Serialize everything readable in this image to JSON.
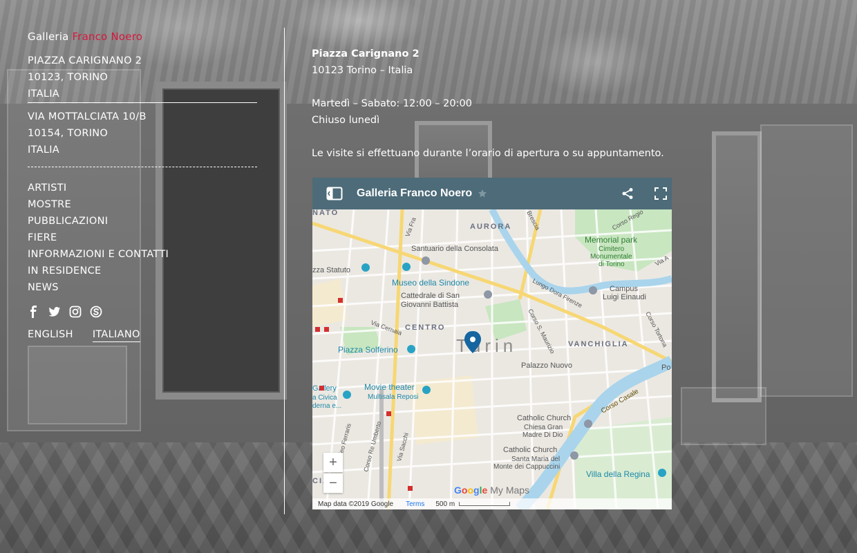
{
  "brand": {
    "prefix": "Galleria",
    "accent": "Franco Noero",
    "accent_color": "#d6183c"
  },
  "addresses": [
    {
      "line1": "PIAZZA CARIGNANO 2",
      "line2": "10123, TORINO",
      "line3": "ITALIA"
    },
    {
      "line1": "VIA MOTTALCIATA 10/B",
      "line2": "10154, TORINO",
      "line3": "ITALIA"
    }
  ],
  "nav": {
    "items": [
      "ARTISTI",
      "MOSTRE",
      "PUBBLICAZIONI",
      "FIERE",
      "INFORMAZIONI E CONTATTI",
      "IN RESIDENCE",
      "NEWS"
    ]
  },
  "social": [
    "facebook-icon",
    "twitter-icon",
    "instagram-icon",
    "skype-icon"
  ],
  "languages": {
    "english": "ENGLISH",
    "italiano": "ITALIANO",
    "active": "ITALIANO"
  },
  "info": {
    "address_title": "Piazza Carignano 2",
    "address_city": "10123 Torino – Italia",
    "hours": "Martedì – Sabato: 12:00 – 20:00",
    "closed": "Chiuso lunedì",
    "visits": "Le visite si effettuano durante l’orario di apertura o su appuntamento."
  },
  "map": {
    "title": "Galleria Franco Noero",
    "header_color": "#4d6b78",
    "labels": {
      "aurora": "AURORA",
      "santuario": "Santuario della Consolata",
      "memorial": "Memorial park",
      "cimitero1": "Cimitero",
      "cimitero2": "Monumentale",
      "cimitero3": "di Torino",
      "statuto": "zza Statuto",
      "museo": "Museo della Sindone",
      "cattedrale1": "Cattedrale di San",
      "cattedrale2": "Giovanni Battista",
      "lungo_dora": "Lungo Dora Firenze",
      "campus1": "Campus",
      "campus2": "Luigi Einaudi",
      "centro": "CENTRO",
      "turin": "Turin",
      "vanchiglia": "VANCHIGLIA",
      "via_cernaia": "Via Cernaia",
      "solferino": "Piazza Solferino",
      "palazzo": "Palazzo Nuovo",
      "corso_san_maurizio": "Corso S. Maurizio",
      "gallery1": "Gallery",
      "gallery2": "a Civica",
      "gallery3": "derna e...",
      "movie1": "Movie theater",
      "movie2": "Multisala Reposi",
      "corso_casale": "Corso Casale",
      "catholic1": "Catholic Church",
      "catholic1_sub1": "Chiesa Gran",
      "catholic1_sub2": "Madre Di Dio",
      "catholic2": "Catholic Church",
      "catholic2_sub1": "Santa Maria del",
      "catholic2_sub2": "Monte dei Cappuccini",
      "villa": "Villa della Regina",
      "ferraris": "Galileo Ferraris",
      "re_umberto": "Corso Re Umberto",
      "via_sacchi": "Via Sacchi",
      "corso_regio": "Corso Regio",
      "via_a": "Via A",
      "corso_tortona": "Corso Tortona",
      "via_fra": "Via Fra",
      "brescia": "Brescia",
      "nato": "NATO",
      "cia": "CIA",
      "po": "Po"
    },
    "zoom_in": "+",
    "zoom_out": "−",
    "google_letters": [
      "G",
      "o",
      "o",
      "g",
      "l",
      "e"
    ],
    "mymaps": "My Maps",
    "map_data": "Map data ©2019 Google",
    "terms": "Terms",
    "scale": "500 m",
    "pin_color": "#1565a0"
  }
}
